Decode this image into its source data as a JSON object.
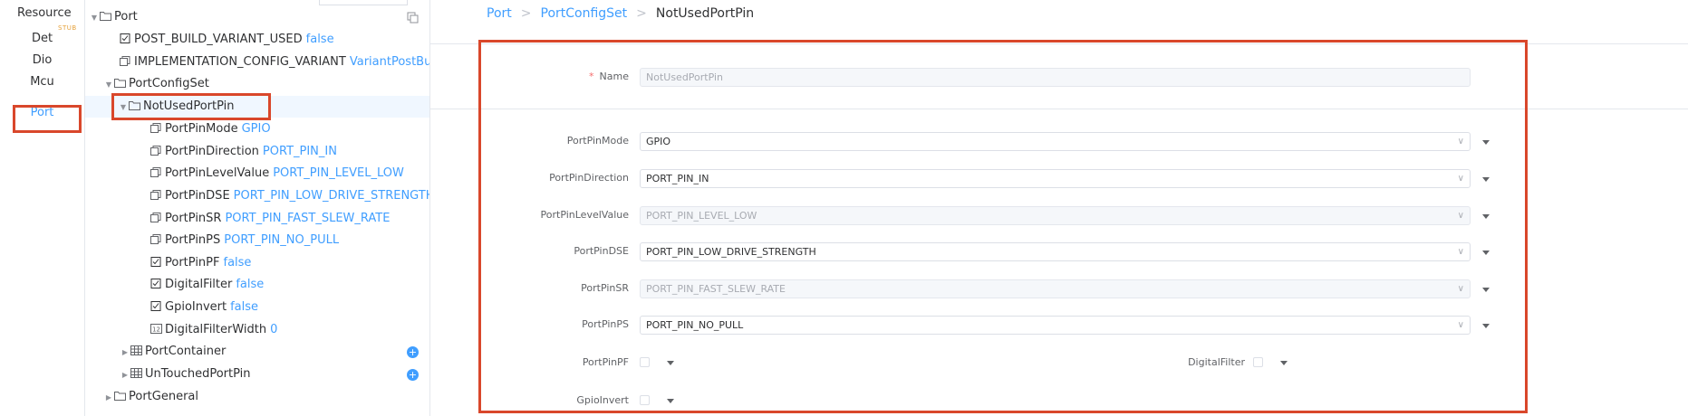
{
  "modules": {
    "header": "Resource",
    "stub_badge": "STUB",
    "items": [
      "Det",
      "Dio",
      "Mcu",
      "Port"
    ],
    "active": "Port"
  },
  "tree": {
    "root": "Port",
    "post_build": {
      "name": "POST_BUILD_VARIANT_USED",
      "value": "false"
    },
    "impl_cfg": {
      "name": "IMPLEMENTATION_CONFIG_VARIANT",
      "value": "VariantPostBuild"
    },
    "config_set": "PortConfigSet",
    "selected": "NotUsedPortPin",
    "params": [
      {
        "name": "PortPinMode",
        "value": "GPIO",
        "icon": "enum"
      },
      {
        "name": "PortPinDirection",
        "value": "PORT_PIN_IN",
        "icon": "enum"
      },
      {
        "name": "PortPinLevelValue",
        "value": "PORT_PIN_LEVEL_LOW",
        "icon": "enum"
      },
      {
        "name": "PortPinDSE",
        "value": "PORT_PIN_LOW_DRIVE_STRENGTH",
        "icon": "enum"
      },
      {
        "name": "PortPinSR",
        "value": "PORT_PIN_FAST_SLEW_RATE",
        "icon": "enum"
      },
      {
        "name": "PortPinPS",
        "value": "PORT_PIN_NO_PULL",
        "icon": "enum"
      },
      {
        "name": "PortPinPF",
        "value": "false",
        "icon": "bool"
      },
      {
        "name": "DigitalFilter",
        "value": "false",
        "icon": "bool"
      },
      {
        "name": "GpioInvert",
        "value": "false",
        "icon": "bool"
      },
      {
        "name": "DigitalFilterWidth",
        "value": "0",
        "icon": "int"
      }
    ],
    "port_container": "PortContainer",
    "untouched": "UnTouchedPortPin",
    "port_general": "PortGeneral"
  },
  "breadcrumb": [
    "Port",
    "PortConfigSet",
    "NotUsedPortPin"
  ],
  "form": {
    "name_label": "Name",
    "name_required": "*",
    "name_value": "NotUsedPortPin",
    "selects": [
      {
        "label": "PortPinMode",
        "value": "GPIO",
        "disabled": false
      },
      {
        "label": "PortPinDirection",
        "value": "PORT_PIN_IN",
        "disabled": false
      },
      {
        "label": "PortPinLevelValue",
        "value": "PORT_PIN_LEVEL_LOW",
        "disabled": true
      },
      {
        "label": "PortPinDSE",
        "value": "PORT_PIN_LOW_DRIVE_STRENGTH",
        "disabled": false
      },
      {
        "label": "PortPinSR",
        "value": "PORT_PIN_FAST_SLEW_RATE",
        "disabled": true
      },
      {
        "label": "PortPinPS",
        "value": "PORT_PIN_NO_PULL",
        "disabled": false
      }
    ],
    "pf_label": "PortPinPF",
    "df_label": "DigitalFilter",
    "gi_label": "GpioInvert"
  },
  "colors": {
    "accent": "#409eff",
    "highlight": "#d9472b",
    "stub": "#e6a23c"
  }
}
